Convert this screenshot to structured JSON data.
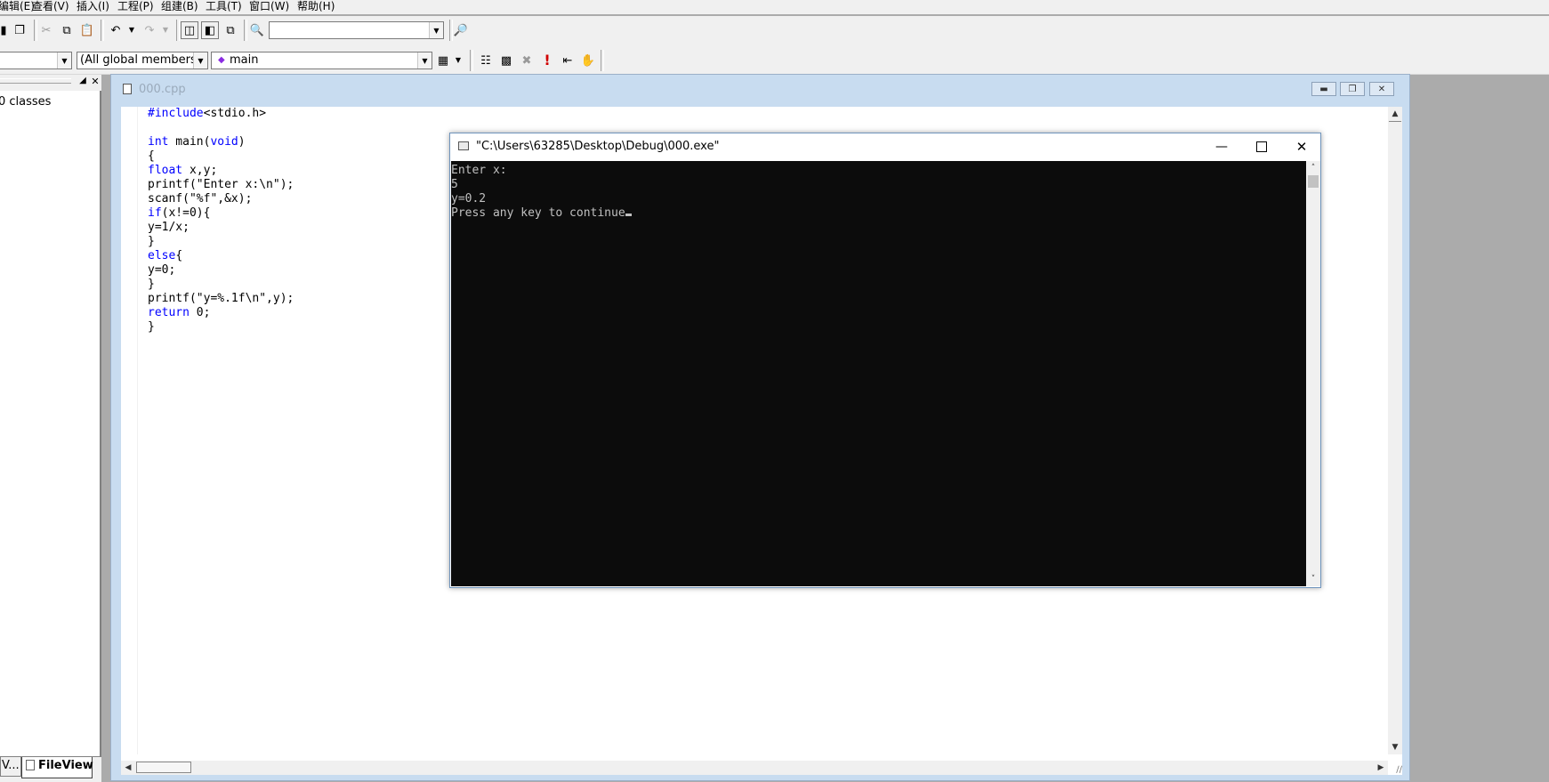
{
  "menu": {
    "items": [
      "编辑(E)",
      "查看(V)",
      "插入(I)",
      "工程(P)",
      "组建(B)",
      "工具(T)",
      "窗口(W)",
      "帮助(H)"
    ]
  },
  "toolbar": {
    "find_combo_value": "",
    "class_combo_value": "",
    "members_combo_value": "(All global members",
    "function_combo_value": "main"
  },
  "workspace": {
    "tree_item": "0 classes",
    "tab_left": "V...",
    "tab_fileview": "FileView"
  },
  "editor": {
    "title": "000.cpp",
    "code_lines": [
      [
        {
          "t": "#include",
          "k": true
        },
        {
          "t": "<stdio.h>",
          "k": false
        }
      ],
      [],
      [
        {
          "t": "int",
          "k": true
        },
        {
          "t": " main(",
          "k": false
        },
        {
          "t": "void",
          "k": true
        },
        {
          "t": ")",
          "k": false
        }
      ],
      [
        {
          "t": "{",
          "k": false
        }
      ],
      [
        {
          "t": "float",
          "k": true
        },
        {
          "t": " x,y;",
          "k": false
        }
      ],
      [
        {
          "t": "printf(\"Enter x:\\n\");",
          "k": false
        }
      ],
      [
        {
          "t": "scanf(\"%f\",&x);",
          "k": false
        }
      ],
      [
        {
          "t": "if",
          "k": true
        },
        {
          "t": "(x!=0){",
          "k": false
        }
      ],
      [
        {
          "t": "y=1/x;",
          "k": false
        }
      ],
      [
        {
          "t": "}",
          "k": false
        }
      ],
      [
        {
          "t": "else",
          "k": true
        },
        {
          "t": "{",
          "k": false
        }
      ],
      [
        {
          "t": "y=0;",
          "k": false
        }
      ],
      [
        {
          "t": "}",
          "k": false
        }
      ],
      [
        {
          "t": "printf(\"y=%.1f\\n\",y);",
          "k": false
        }
      ],
      [
        {
          "t": "return",
          "k": true
        },
        {
          "t": " 0;",
          "k": false
        }
      ],
      [
        {
          "t": "}",
          "k": false
        }
      ]
    ]
  },
  "console": {
    "title": "\"C:\\Users\\63285\\Desktop\\Debug\\000.exe\"",
    "lines": [
      "Enter x:",
      "5",
      "y=0.2",
      "Press any key to continue"
    ]
  },
  "colors": {
    "keyword": "#0000ff",
    "console_bg": "#0c0c0c",
    "console_text": "#c0c0c0",
    "mdi_bg": "#ababab"
  }
}
